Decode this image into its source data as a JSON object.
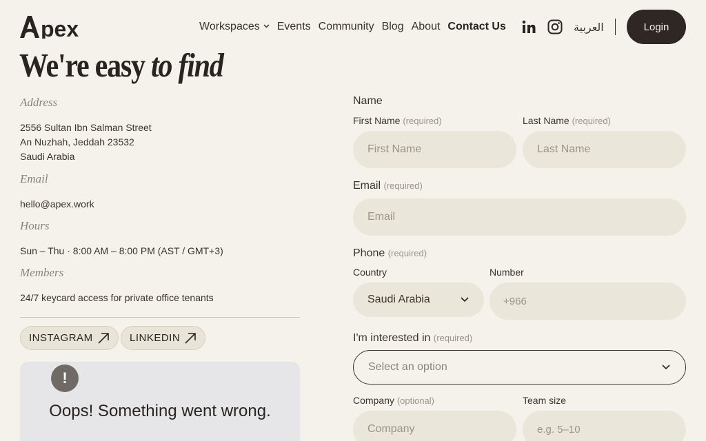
{
  "brand": {
    "name": "Apex"
  },
  "nav": {
    "items": [
      "Workspaces",
      "Events",
      "Community",
      "Blog",
      "About",
      "Contact Us"
    ],
    "language": "العربية",
    "login": "Login"
  },
  "contact": {
    "title_plain": "We're easy ",
    "title_italic": "to find",
    "address_label": "Address",
    "address_lines": [
      "2556 Sultan Ibn Salman Street",
      "An Nuzhah, Jeddah 23532",
      "Saudi Arabia"
    ],
    "email_label": "Email",
    "email": "hello@apex.work",
    "hours_label": "Hours",
    "hours": "Sun – Thu · 8:00 AM – 8:00 PM (AST / GMT+3)",
    "members_label": "Members",
    "members": "24/7 keycard access for private office tenants",
    "social": [
      "INSTAGRAM",
      "LINKEDIN"
    ],
    "error_message": "Oops! Something went wrong."
  },
  "form": {
    "name_label": "Name",
    "first_name_label": "First Name",
    "last_name_label": "Last Name",
    "required": "(required)",
    "optional": "(optional)",
    "first_name_placeholder": "First Name",
    "last_name_placeholder": "Last Name",
    "email_label": "Email",
    "email_placeholder": "Email",
    "phone_label": "Phone",
    "country_label": "Country",
    "country_value": "Saudi Arabia",
    "number_label": "Number",
    "number_placeholder": "+966",
    "interest_label": "I'm interested in",
    "interest_placeholder": "Select an option",
    "company_label": "Company",
    "company_placeholder": "Company",
    "team_label": "Team size",
    "team_placeholder": "e.g. 5–10"
  }
}
